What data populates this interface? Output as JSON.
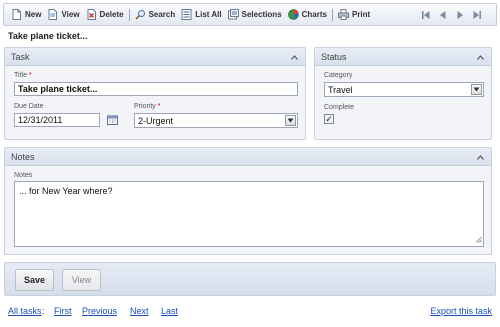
{
  "toolbar": {
    "items": [
      {
        "label": "New",
        "icon": "new-document-icon"
      },
      {
        "label": "View",
        "icon": "view-document-icon"
      },
      {
        "label": "Delete",
        "icon": "delete-icon"
      },
      {
        "label": "Search",
        "icon": "search-icon"
      },
      {
        "label": "List All",
        "icon": "list-icon"
      },
      {
        "label": "Selections",
        "icon": "selections-icon"
      },
      {
        "label": "Charts",
        "icon": "charts-icon"
      },
      {
        "label": "Print",
        "icon": "print-icon"
      }
    ],
    "nav_icons": [
      "first-record-icon",
      "previous-record-icon",
      "next-record-icon",
      "last-record-icon"
    ]
  },
  "record_title": "Take plane ticket...",
  "task_panel": {
    "title": "Task",
    "title_label": "Title",
    "title_required": "*",
    "title_value": "Take plane ticket...",
    "due_date_label": "Due Date",
    "due_date_value": "12/31/2011",
    "priority_label": "Priority",
    "priority_required": "*",
    "priority_value": "2-Urgent"
  },
  "status_panel": {
    "title": "Status",
    "category_label": "Category",
    "category_value": "Travel",
    "complete_label": "Complete",
    "complete_checked": true,
    "complete_mark": "✓"
  },
  "notes_panel": {
    "title": "Notes",
    "notes_label": "Notes",
    "notes_value": "... for New Year where?"
  },
  "buttons": {
    "save_label": "Save",
    "view_label": "View"
  },
  "footer": {
    "all_tasks": "All tasks",
    "colon": ":",
    "first": "First",
    "previous": "Previous",
    "next": "Next",
    "last": "Last",
    "export": "Export this task"
  },
  "colors": {
    "accent": "#1a4fb5",
    "panel_header": "#dbe3ef",
    "required": "#cc0000"
  }
}
